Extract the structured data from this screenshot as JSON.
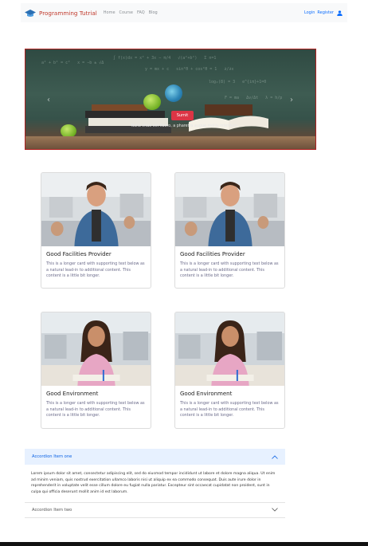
{
  "brand": {
    "title": "Programming Tutrial",
    "logo_icon": "graduation-cap-icon"
  },
  "nav": {
    "links": [
      "Home",
      "Course",
      "FAQ",
      "Blog"
    ],
    "login": "Login",
    "register": "Register",
    "user_icon": "user-icon"
  },
  "carousel": {
    "button_label": "Sumit",
    "caption": "Nulla vitae elit libero, a pharetra augue mollis interdum."
  },
  "cards": [
    {
      "title": "Good Facilities Provider",
      "text": "This is a longer card with supporting text below as a natural lead-in to additional content. This content is a little bit longer."
    },
    {
      "title": "Good Facilities Provider",
      "text": "This is a longer card with supporting text below as a natural lead-in to additional content. This content is a little bit longer."
    },
    {
      "title": "Good Environment",
      "text": "This is a longer card with supporting text below as a natural lead-in to additional content. This content is a little bit longer."
    },
    {
      "title": "Good Environment",
      "text": "This is a longer card with supporting text below as a natural lead-in to additional content. This content is a little bit longer."
    }
  ],
  "accordion": {
    "items": [
      {
        "title": "Accordion Item one",
        "body": "Lorem ipsum dolor sit amet, consectetur adipiscing elit, sed do eiusmod tempor incididunt ut labore et dolore magna aliqua. Ut enim ad minim veniam, quis nostrud exercitation ullamco laboris nisi ut aliquip ex ea commodo consequat. Duis aute irure dolor in reprehenderit in voluptate velit esse cillum dolore eu fugiat nulla pariatur. Excepteur sint occaecat cupidatat non proident, sunt in culpa qui officia deserunt mollit anim id est laborum."
      },
      {
        "title": "Accordion Item two"
      }
    ]
  },
  "colors": {
    "brand_red": "#c0392b",
    "link_blue": "#0d6efd",
    "button_red": "#dc3545",
    "accordion_active_bg": "#e7f1ff"
  }
}
